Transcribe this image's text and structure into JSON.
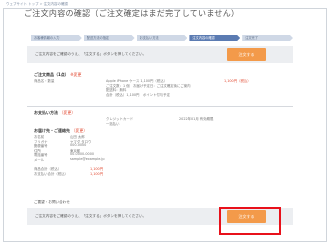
{
  "breadcrumb": [
    "ウェブサイト トップ",
    "注文内容の確認"
  ],
  "page_title": "ご注文内容の確認（ご注文確定はまだ完了していません）",
  "steps": [
    {
      "label": "お客様情報の入力",
      "active": false
    },
    {
      "label": "配送方法の指定",
      "active": false
    },
    {
      "label": "お支払い方法",
      "active": false
    },
    {
      "label": "注文内容の確認",
      "active": true
    },
    {
      "label": "注文完了",
      "active": false
    }
  ],
  "top_bar": {
    "text": "ご注文内容をご確認のうえ、「注文する」ボタンを押してください。",
    "button": "注文する"
  },
  "bottom_bar": {
    "text": "ご注文内容をご確認のうえ、「注文する」ボタンを押してください。",
    "button": "注文する"
  },
  "order_section": {
    "title": "ご注文商品（1点）",
    "note": "※変更",
    "price_note": "1,100円（税込）",
    "rows": [
      {
        "label": "商品名・数量",
        "value": "Apple iPhone ケース 1,100円（税込）",
        "value2": ""
      },
      {
        "label": "",
        "value": "ご注文数：1 個　お届け予定日：ご注文確定後にご案内",
        "value2": ""
      },
      {
        "label": "",
        "value": "配送料：無料",
        "value2": ""
      },
      {
        "label": "",
        "value": "合計（税込）1,100円　ポイント付与予定",
        "value2": ""
      }
    ]
  },
  "payment_section": {
    "title": "お支払い方法",
    "note": "（変更）",
    "rows": [
      {
        "label": "",
        "value": "クレジットカード",
        "value2": "2022年01月 有効期限"
      },
      {
        "label": "",
        "value": "一括払い",
        "value2": ""
      }
    ]
  },
  "delivery_section": {
    "title": "お届け先・ご連絡先",
    "note": "（変更）",
    "rows": [
      {
        "label": "お名前",
        "value": "山田 太郎",
        "value2": ""
      },
      {
        "label": "フリガナ",
        "value": "ヤマダ タロウ",
        "value2": ""
      },
      {
        "label": "郵便番号",
        "value": "000-0000",
        "value2": ""
      },
      {
        "label": "住所",
        "value": "東京都",
        "value2": ""
      },
      {
        "label": "電話番号",
        "value": "00-0000-0000",
        "value2": ""
      },
      {
        "label": "メール",
        "value": "sample@example.jp",
        "value2": ""
      }
    ]
  },
  "total_section": {
    "rows": [
      {
        "label": "商品合計（税込）",
        "value": "1,100円",
        "value2": ""
      },
      {
        "label": "お支払い合計（税込）",
        "value": "1,100円",
        "value2": ""
      }
    ]
  },
  "memo_section": {
    "title": "ご要望・お問い合わせ"
  },
  "colors": {
    "accent_orange": "#f39a4a",
    "active_step": "#5b7bb2",
    "highlight_red": "#e8111b",
    "note_red": "#e1472f"
  }
}
